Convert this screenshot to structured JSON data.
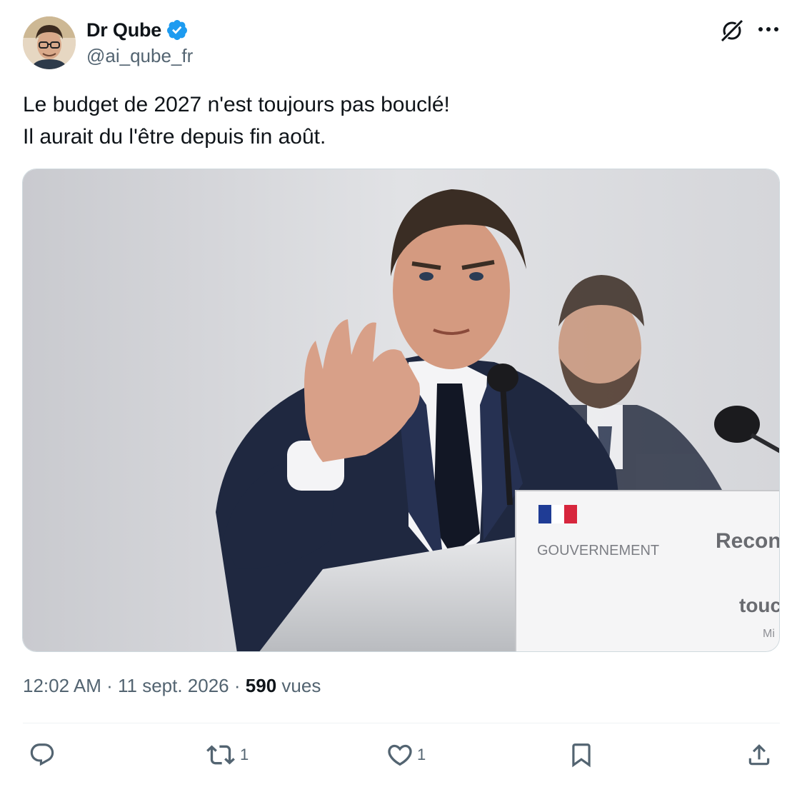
{
  "author": {
    "display_name": "Dr Qube",
    "handle": "@ai_qube_fr",
    "verified": true,
    "verified_color": "#1d9bf0",
    "avatar_icon": "profile-photo"
  },
  "header_actions": {
    "grok_icon": "grok-icon",
    "more_icon": "more-horizontal-icon"
  },
  "tweet": {
    "text_lines": [
      "Le budget de 2027 n'est toujours pas bouclé!",
      "Il aurait du l'être depuis fin août."
    ],
    "media": {
      "type": "photo",
      "placard_lines": [
        "GOUVERNEMENT",
        "Recons",
        "touc",
        "Mi"
      ]
    }
  },
  "meta": {
    "time": "12:02 AM",
    "separator": "·",
    "date": "11 sept. 2026",
    "views_count": "590",
    "views_label": "vues"
  },
  "actions": {
    "reply": {
      "icon": "reply-icon",
      "count": ""
    },
    "retweet": {
      "icon": "retweet-icon",
      "count": "1"
    },
    "like": {
      "icon": "heart-icon",
      "count": "1"
    },
    "bookmark": {
      "icon": "bookmark-icon",
      "count": ""
    },
    "share": {
      "icon": "share-icon",
      "count": ""
    }
  },
  "colors": {
    "text_primary": "#0f1419",
    "text_secondary": "#536471",
    "divider": "#eff3f4",
    "verified_blue": "#1d9bf0"
  }
}
